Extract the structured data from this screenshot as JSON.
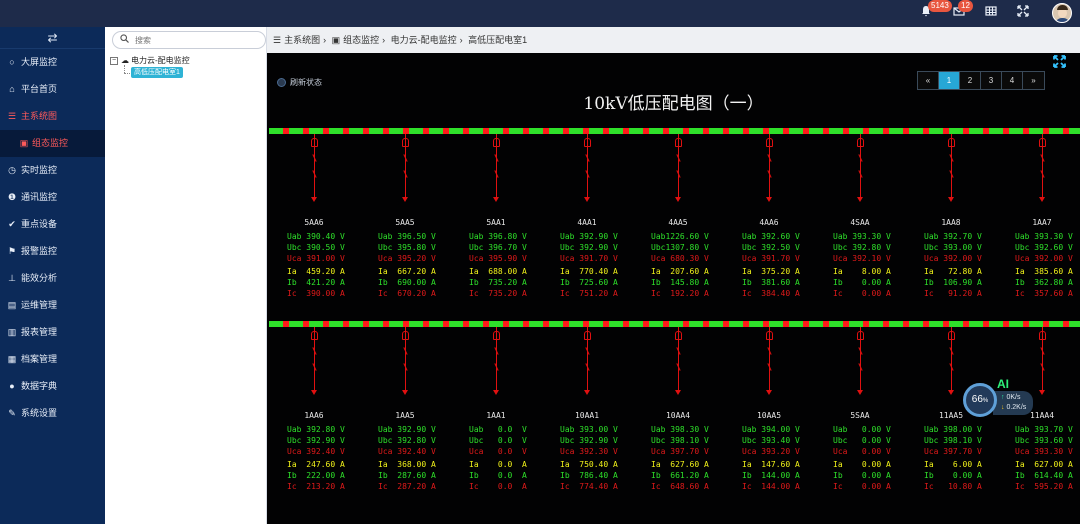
{
  "topbar": {
    "badges": [
      "5143",
      "12"
    ],
    "icons": [
      "bell-icon",
      "mail-icon",
      "grid-icon",
      "expand-icon"
    ]
  },
  "sidebar": {
    "toggle_icon": "swap-icon",
    "items": [
      {
        "label": "大屏监控",
        "icon": "circle-icon"
      },
      {
        "label": "平台首页",
        "icon": "home-icon"
      },
      {
        "label": "主系统图",
        "icon": "list-icon",
        "active": true
      },
      {
        "label": "组态监控",
        "icon": "image-icon",
        "sub": true
      },
      {
        "label": "实时监控",
        "icon": "clock-icon"
      },
      {
        "label": "通讯监控",
        "icon": "info-icon"
      },
      {
        "label": "重点设备",
        "icon": "check-icon"
      },
      {
        "label": "报警监控",
        "icon": "flag-icon"
      },
      {
        "label": "能效分析",
        "icon": "pin-icon"
      },
      {
        "label": "运维管理",
        "icon": "book-icon"
      },
      {
        "label": "报表管理",
        "icon": "file-icon"
      },
      {
        "label": "档案管理",
        "icon": "archive-icon"
      },
      {
        "label": "数据字典",
        "icon": "dot-icon"
      },
      {
        "label": "系统设置",
        "icon": "wrench-icon"
      }
    ]
  },
  "tree": {
    "search_placeholder": "搜索",
    "root": "电力云-配电监控",
    "child": "高低压配电室1"
  },
  "breadcrumb": [
    "主系统图",
    "组态监控",
    "电力云-配电监控",
    "高低压配电室1"
  ],
  "main": {
    "refresh_label": "刷新状态",
    "title": "10kV低压配电图（一）",
    "pager": [
      "«",
      "1",
      "2",
      "3",
      "4",
      "»"
    ],
    "pager_active": 1,
    "feeders_top": [
      {
        "name": "5AA6",
        "uab": "Uab 390.40 V",
        "ubc": "Ubc 390.50 V",
        "uca": "Uca 391.00 V",
        "ia": "Ia  459.20 A",
        "ib": "Ib  421.20 A",
        "ic": "Ic  390.00 A"
      },
      {
        "name": "5AA5",
        "uab": "Uab 396.50 V",
        "ubc": "Ubc 395.80 V",
        "uca": "Uca 395.20 V",
        "ia": "Ia  667.20 A",
        "ib": "Ib  690.00 A",
        "ic": "Ic  670.20 A"
      },
      {
        "name": "5AA1",
        "uab": "Uab 396.80 V",
        "ubc": "Ubc 396.70 V",
        "uca": "Uca 395.90 V",
        "ia": "Ia  688.00 A",
        "ib": "Ib  735.20 A",
        "ic": "Ic  735.20 A"
      },
      {
        "name": "4AA1",
        "uab": "Uab 392.90 V",
        "ubc": "Ubc 392.90 V",
        "uca": "Uca 391.70 V",
        "ia": "Ia  770.40 A",
        "ib": "Ib  725.60 A",
        "ic": "Ic  751.20 A"
      },
      {
        "name": "4AA5",
        "uab": "Uab1226.60 V",
        "ubc": "Ubc1307.80 V",
        "uca": "Uca 680.30 V",
        "ia": "Ia  207.60 A",
        "ib": "Ib  145.80 A",
        "ic": "Ic  192.20 A"
      },
      {
        "name": "4AA6",
        "uab": "Uab 392.60 V",
        "ubc": "Ubc 392.50 V",
        "uca": "Uca 391.70 V",
        "ia": "Ia  375.20 A",
        "ib": "Ib  381.60 A",
        "ic": "Ic  384.40 A"
      },
      {
        "name": "4SAA",
        "uab": "Uab 393.30 V",
        "ubc": "Ubc 392.80 V",
        "uca": "Uca 392.10 V",
        "ia": "Ia    8.00 A",
        "ib": "Ib    0.00 A",
        "ic": "Ic    0.00 A"
      },
      {
        "name": "1AA8",
        "uab": "Uab 392.70 V",
        "ubc": "Ubc 393.00 V",
        "uca": "Uca 392.00 V",
        "ia": "Ia   72.80 A",
        "ib": "Ib  106.90 A",
        "ic": "Ic   91.20 A"
      },
      {
        "name": "1AA7",
        "uab": "Uab 393.30 V",
        "ubc": "Ubc 392.60 V",
        "uca": "Uca 392.00 V",
        "ia": "Ia  385.60 A",
        "ib": "Ib  362.80 A",
        "ic": "Ic  357.60 A"
      }
    ],
    "feeders_bottom": [
      {
        "name": "1AA6",
        "uab": "Uab 392.80 V",
        "ubc": "Ubc 392.90 V",
        "uca": "Uca 392.40 V",
        "ia": "Ia  247.60 A",
        "ib": "Ib  222.00 A",
        "ic": "Ic  213.20 A"
      },
      {
        "name": "1AA5",
        "uab": "Uab 392.90 V",
        "ubc": "Ubc 392.80 V",
        "uca": "Uca 392.40 V",
        "ia": "Ia  368.00 A",
        "ib": "Ib  287.60 A",
        "ic": "Ic  287.20 A"
      },
      {
        "name": "1AA1",
        "uab": "Uab   0.0  V",
        "ubc": "Ubc   0.0  V",
        "uca": "Uca   0.0  V",
        "ia": "Ia    0.0  A",
        "ib": "Ib    0.0  A",
        "ic": "Ic    0.0  A"
      },
      {
        "name": "10AA1",
        "uab": "Uab 393.00 V",
        "ubc": "Ubc 392.90 V",
        "uca": "Uca 392.30 V",
        "ia": "Ia  750.40 A",
        "ib": "Ib  786.40 A",
        "ic": "Ic  774.40 A"
      },
      {
        "name": "10AA4",
        "uab": "Uab 398.30 V",
        "ubc": "Ubc 398.10 V",
        "uca": "Uca 397.70 V",
        "ia": "Ia  627.60 A",
        "ib": "Ib  661.20 A",
        "ic": "Ic  648.60 A"
      },
      {
        "name": "10AA5",
        "uab": "Uab 394.00 V",
        "ubc": "Ubc 393.40 V",
        "uca": "Uca 393.20 V",
        "ia": "Ia  147.60 A",
        "ib": "Ib  144.00 A",
        "ic": "Ic  144.00 A"
      },
      {
        "name": "5SAA",
        "uab": "Uab   0.00 V",
        "ubc": "Ubc   0.00 V",
        "uca": "Uca   0.00 V",
        "ia": "Ia    0.00 A",
        "ib": "Ib    0.00 A",
        "ic": "Ic    0.00 A"
      },
      {
        "name": "11AA5",
        "uab": "Uab 398.00 V",
        "ubc": "Ubc 398.10 V",
        "uca": "Uca 397.70 V",
        "ia": "Ia    6.00 A",
        "ib": "Ib    0.00 A",
        "ic": "Ic   10.80 A"
      },
      {
        "name": "11AA4",
        "uab": "Uab 393.70 V",
        "ubc": "Ubc 393.60 V",
        "uca": "Uca 393.30 V",
        "ia": "Ia  627.00 A",
        "ib": "Ib  614.40 A",
        "ic": "Ic  595.20 A"
      }
    ]
  },
  "ai_widget": {
    "label": "AI",
    "percent": "66",
    "percent_unit": "%",
    "up_rate": "0K/s",
    "down_rate": "0.2K/s"
  }
}
